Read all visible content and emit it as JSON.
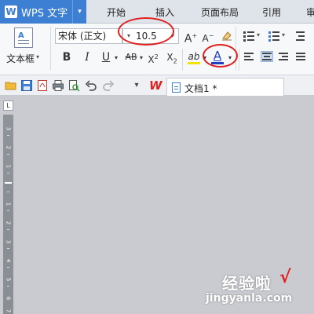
{
  "app": {
    "title": "WPS 文字",
    "logo_glyph": "W",
    "menu_caret": "▾",
    "accent": "#3d7fd3"
  },
  "menu_tabs": [
    "开始",
    "插入",
    "页面布局",
    "引用",
    "审"
  ],
  "ribbon": {
    "textbox_label": "文本框",
    "textbox_caret": "▾",
    "font_name": "宋体 (正文)",
    "font_size": "10.5",
    "grow_font": "A",
    "shrink_font": "A",
    "bold": "B",
    "italic": "I",
    "underline": "U",
    "strikethrough": "AB",
    "superscript": "X",
    "subscript": "X",
    "highlight": "ab",
    "font_color": "A",
    "font_color_value": "#1f3fbf",
    "highlight_color": "#f5e200",
    "annotation_color": "#e0201e",
    "dropdown": "▾"
  },
  "quickbar": {
    "doc_tab": "文档1 *",
    "wps_mark": "W"
  },
  "ruler": {
    "corner": "L",
    "numbers": [
      "3",
      "2",
      "1",
      "1",
      "2",
      "3",
      "4",
      "5",
      "6",
      "7",
      "8"
    ]
  },
  "watermark": {
    "main": "经验啦",
    "check": "√",
    "url": "jingyanla.com"
  }
}
